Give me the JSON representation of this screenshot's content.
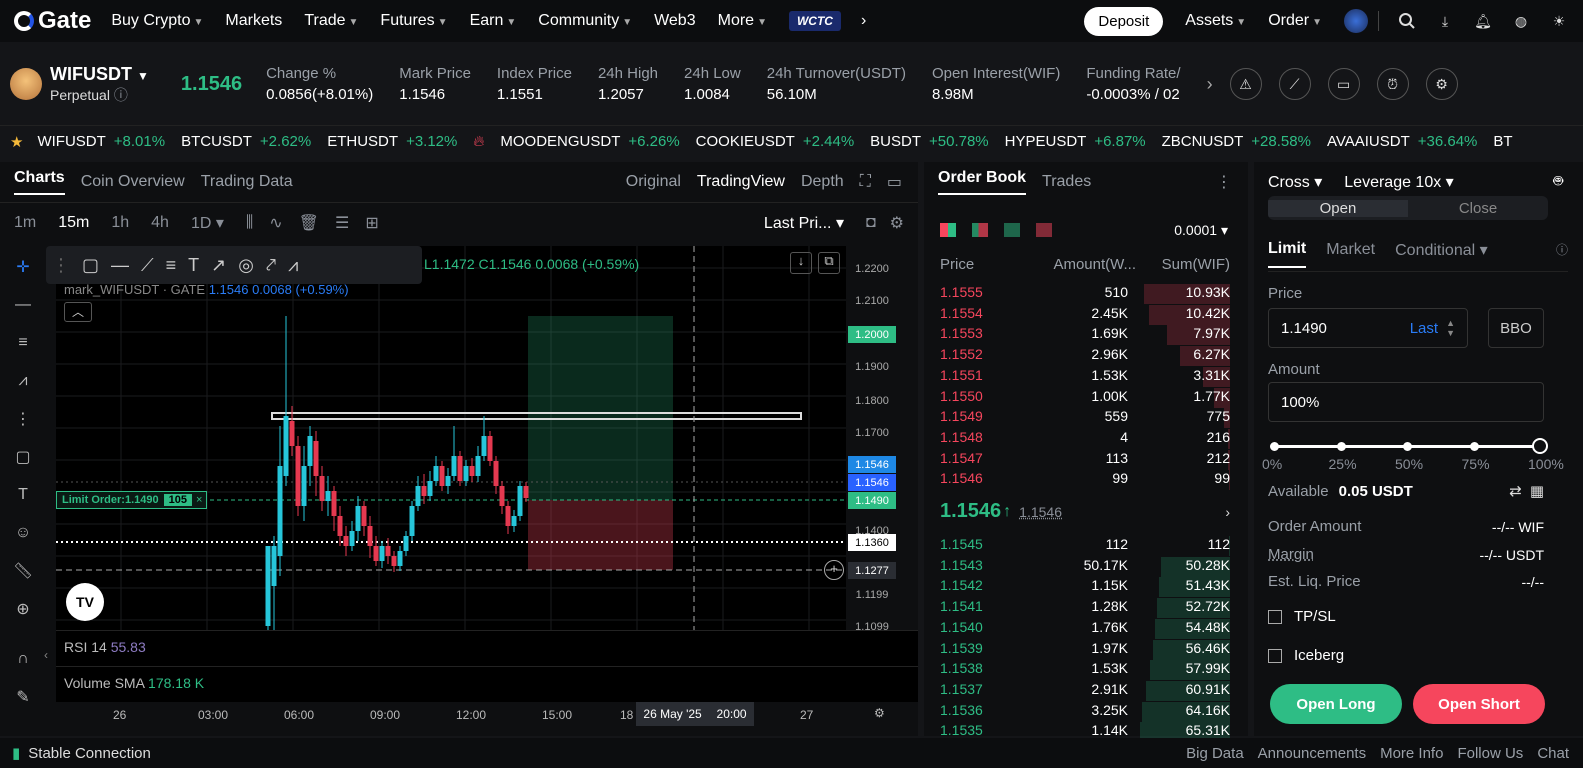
{
  "nav": {
    "logo": "Gate",
    "items": [
      "Buy Crypto",
      "Markets",
      "Trade",
      "Futures",
      "Earn",
      "Community",
      "Web3",
      "More"
    ],
    "badge": "WCTC",
    "deposit": "Deposit",
    "assets": "Assets",
    "order": "Order"
  },
  "ticker": {
    "pair": "WIFUSDT",
    "type": "Perpetual",
    "price": "1.1546",
    "stats": [
      {
        "label": "Change %",
        "value": "0.0856(+8.01%)",
        "color": "g"
      },
      {
        "label": "Mark Price",
        "value": "1.1546"
      },
      {
        "label": "Index Price",
        "value": "1.1551"
      },
      {
        "label": "24h High",
        "value": "1.2057"
      },
      {
        "label": "24h Low",
        "value": "1.0084"
      },
      {
        "label": "24h Turnover(USDT)",
        "value": "56.10M"
      },
      {
        "label": "Open Interest(WIF)",
        "value": "8.98M"
      },
      {
        "label": "Funding Rate/",
        "value": "-0.0003% / 02",
        "color": "r"
      }
    ]
  },
  "marquee": [
    {
      "sym": "WIFUSDT",
      "chg": "+8.01%"
    },
    {
      "sym": "BTCUSDT",
      "chg": "+2.62%"
    },
    {
      "sym": "ETHUSDT",
      "chg": "+3.12%"
    },
    {
      "sym": "MOODENGUSDT",
      "chg": "+6.26%"
    },
    {
      "sym": "COOKIEUSDT",
      "chg": "+2.44%"
    },
    {
      "sym": "BUSDT",
      "chg": "+50.78%"
    },
    {
      "sym": "HYPEUSDT",
      "chg": "+6.87%"
    },
    {
      "sym": "ZBCNUSDT",
      "chg": "+28.58%"
    },
    {
      "sym": "AVAAIUSDT",
      "chg": "+36.64%"
    },
    {
      "sym": "BT",
      "chg": ""
    }
  ],
  "charts": {
    "tabs": [
      "Charts",
      "Coin Overview",
      "Trading Data"
    ],
    "views": [
      "Original",
      "TradingView",
      "Depth"
    ],
    "intervals": [
      "1m",
      "15m",
      "1h",
      "4h",
      "1D"
    ],
    "price_type": "Last Pri...",
    "ohlc": "L1.1472  C1.1546  0.0068 (+0.59%)",
    "mark_label": "mark_WIFUSDT · GATE",
    "mark_vals": "1.1546  0.0068 (+0.59%)",
    "limit_order": "Limit Order:1.1490",
    "limit_qty": "105",
    "rsi_label": "RSI 14",
    "rsi_val": "55.83",
    "vol_label": "Volume SMA",
    "vol_val": "178.18 K",
    "y_ticks": [
      "1.2200",
      "1.2100",
      "1.2000",
      "1.1900",
      "1.1800",
      "1.1700",
      "1.1546",
      "1.1546",
      "1.1490",
      "1.1400",
      "1.1360",
      "1.1277",
      "1.1199",
      "1.1099"
    ],
    "x_ticks": [
      "26",
      "03:00",
      "06:00",
      "09:00",
      "12:00",
      "15:00",
      "18",
      "27"
    ],
    "cursor_date": "26 May '25",
    "cursor_time": "20:00"
  },
  "book": {
    "tabs": [
      "Order Book",
      "Trades"
    ],
    "tick": "0.0001",
    "headers": [
      "Price",
      "Amount(W...",
      "Sum(WIF)"
    ],
    "asks": [
      [
        "1.1555",
        "510",
        "10.93K",
        0.95
      ],
      [
        "1.1554",
        "2.45K",
        "10.42K",
        0.9
      ],
      [
        "1.1553",
        "1.69K",
        "7.97K",
        0.7
      ],
      [
        "1.1552",
        "2.96K",
        "6.27K",
        0.55
      ],
      [
        "1.1551",
        "1.53K",
        "3.31K",
        0.3
      ],
      [
        "1.1550",
        "1.00K",
        "1.77K",
        0.18
      ],
      [
        "1.1549",
        "559",
        "775",
        0.07
      ],
      [
        "1.1548",
        "4",
        "216",
        0.02
      ],
      [
        "1.1547",
        "113",
        "212",
        0.02
      ],
      [
        "1.1546",
        "99",
        "99",
        0.01
      ]
    ],
    "last": "1.1546",
    "mark": "1.1546",
    "bids": [
      [
        "1.1545",
        "112",
        "112",
        0.01
      ],
      [
        "1.1543",
        "50.17K",
        "50.28K",
        0.77
      ],
      [
        "1.1542",
        "1.15K",
        "51.43K",
        0.79
      ],
      [
        "1.1541",
        "1.28K",
        "52.72K",
        0.81
      ],
      [
        "1.1540",
        "1.76K",
        "54.48K",
        0.83
      ],
      [
        "1.1539",
        "1.97K",
        "56.46K",
        0.86
      ],
      [
        "1.1538",
        "1.53K",
        "57.99K",
        0.89
      ],
      [
        "1.1537",
        "2.91K",
        "60.91K",
        0.93
      ],
      [
        "1.1536",
        "3.25K",
        "64.16K",
        0.98
      ],
      [
        "1.1535",
        "1.14K",
        "65.31K",
        1.0
      ]
    ]
  },
  "trade": {
    "margin_mode": "Cross",
    "leverage": "Leverage 10x",
    "open": "Open",
    "close": "Close",
    "types": [
      "Limit",
      "Market",
      "Conditional"
    ],
    "price_label": "Price",
    "price": "1.1490",
    "last": "Last",
    "bbo": "BBO",
    "amount_label": "Amount",
    "amount": "100%",
    "slider": [
      "0%",
      "25%",
      "50%",
      "75%",
      "100%"
    ],
    "available_label": "Available",
    "available": "0.05 USDT",
    "order_amount_label": "Order Amount",
    "order_amount": "--/-- WIF",
    "margin_label": "Margin",
    "margin": "--/-- USDT",
    "liq_label": "Est. Liq. Price",
    "liq": "--/--",
    "tpsl": "TP/SL",
    "iceberg": "Iceberg",
    "long": "Open Long",
    "short": "Open Short"
  },
  "footer": {
    "status": "Stable Connection",
    "links": [
      "Big Data",
      "Announcements",
      "More Info",
      "Follow Us",
      "Chat"
    ]
  },
  "colors": {
    "up": "#2ebd85",
    "down": "#f6465d",
    "bg": "#0e0f11"
  }
}
